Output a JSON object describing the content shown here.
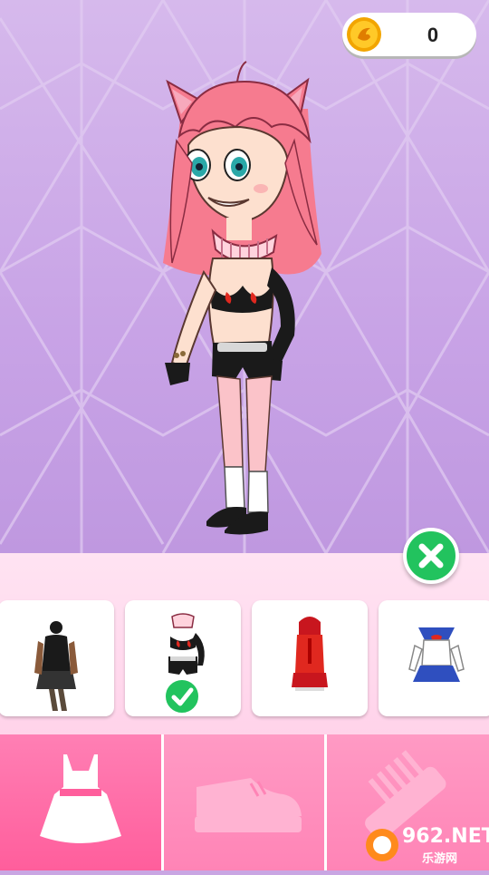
{
  "coins": {
    "value": "0"
  },
  "outfits": [
    {
      "name": "black-lace-dress",
      "selected": false
    },
    {
      "name": "red-black-bikini-outfit",
      "selected": true
    },
    {
      "name": "red-hooded-dress",
      "selected": false
    },
    {
      "name": "sailor-uniform",
      "selected": false
    }
  ],
  "tabs": [
    {
      "icon": "dress-icon",
      "active": true
    },
    {
      "icon": "shoe-icon",
      "active": false
    },
    {
      "icon": "comb-icon",
      "active": false
    }
  ],
  "watermark": {
    "main": "962.NET",
    "sub": "乐游网"
  },
  "colors": {
    "accent_green": "#22c35e",
    "tab_active": "#ff5e9c",
    "tab_inactive": "#ff84b6",
    "background": "#c8a3e6"
  }
}
